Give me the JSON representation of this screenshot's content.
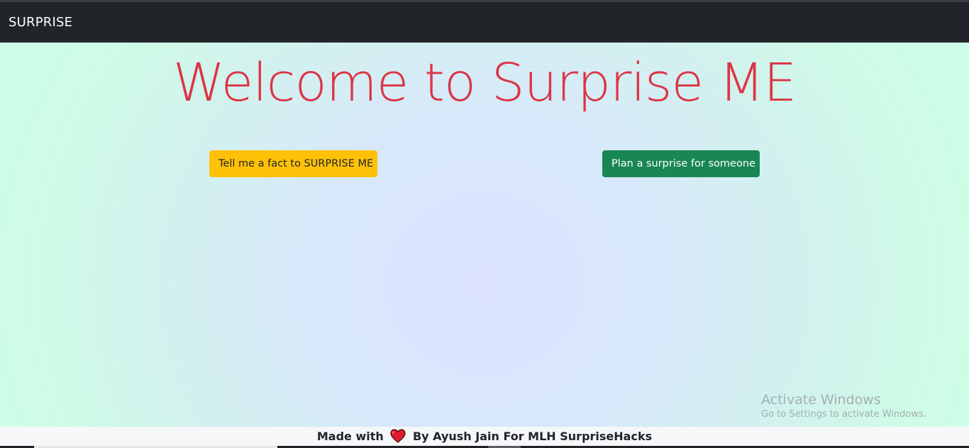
{
  "navbar": {
    "brand": "SURPRISE"
  },
  "main": {
    "heading": "Welcome to Surprise ME",
    "fact_button_label": "Tell me a fact to SURPRISE ME",
    "plan_button_label": "Plan a surprise for someone"
  },
  "watermark": {
    "title": "Activate Windows",
    "subtitle": "Go to Settings to activate Windows."
  },
  "footer": {
    "text_before": "Made with",
    "icon": "heart-icon",
    "text_after": "By Ayush Jain For MLH SurpriseHacks"
  },
  "colors": {
    "navbar_bg": "#212529",
    "heading": "#dc3545",
    "fact_button": "#ffc107",
    "plan_button": "#198754",
    "heart": "#e21b2c"
  }
}
